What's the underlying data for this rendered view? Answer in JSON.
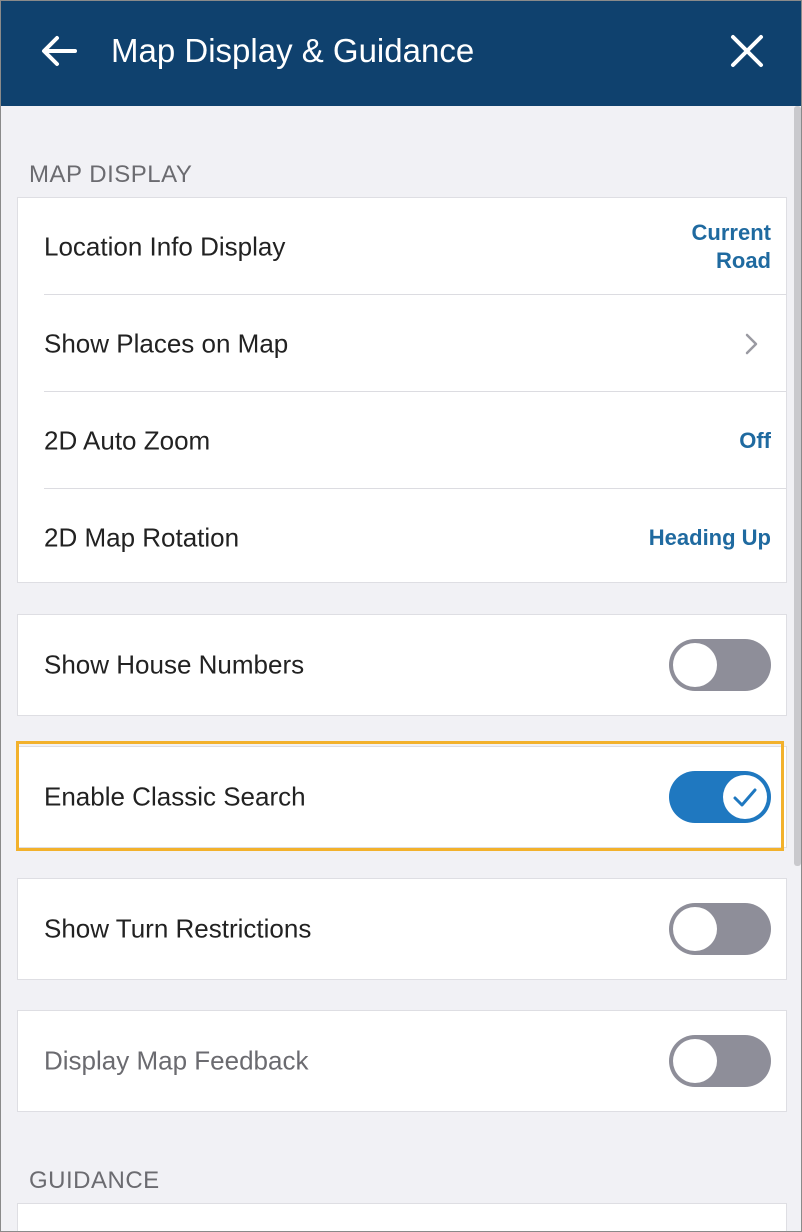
{
  "header": {
    "title": "Map Display & Guidance",
    "back_icon": "back-arrow-icon",
    "close_icon": "close-icon"
  },
  "sections": {
    "map_display": "MAP DISPLAY",
    "guidance": "GUIDANCE"
  },
  "map_display_items": [
    {
      "label": "Location Info Display",
      "value": "Current Road"
    },
    {
      "label": "Show Places on Map",
      "icon": "chevron-right-icon"
    },
    {
      "label": "2D Auto Zoom",
      "value": "Off"
    },
    {
      "label": "2D Map Rotation",
      "value": "Heading Up"
    }
  ],
  "toggles": [
    {
      "label": "Show House Numbers",
      "on": false
    },
    {
      "label": "Enable Classic Search",
      "on": true
    },
    {
      "label": "Show Turn Restrictions",
      "on": false
    },
    {
      "label": "Display Map Feedback",
      "on": false
    }
  ],
  "colors": {
    "header_bg": "#0f416e",
    "accent": "#1f6aa0",
    "toggle_on": "#1f78c0",
    "toggle_off": "#8e8e99",
    "highlight": "#f2b12c"
  }
}
